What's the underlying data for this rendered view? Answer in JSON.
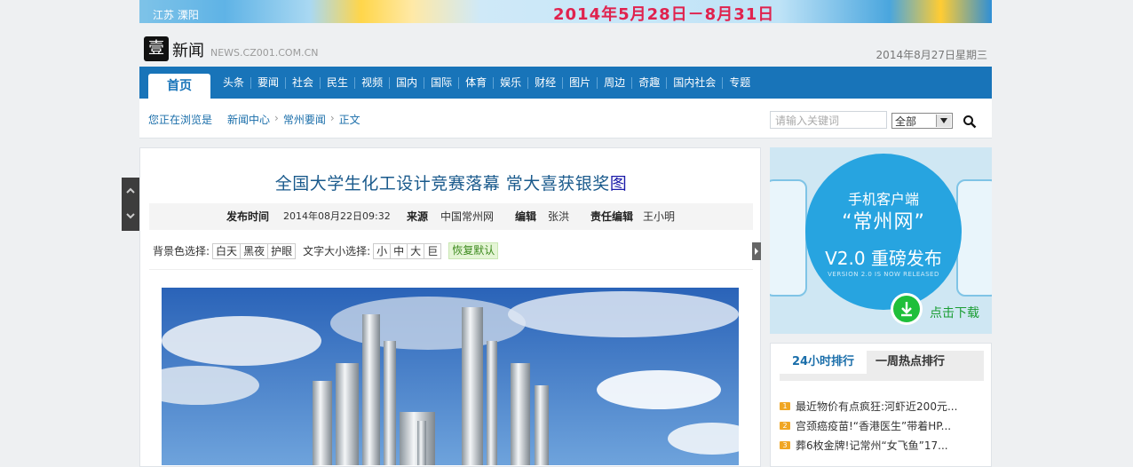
{
  "banner": {
    "location": "江苏  溧阳",
    "date_range": "2014年5月28日－8月31日"
  },
  "header": {
    "logo_char": "壹",
    "logo_text": "新闻",
    "site_url": "NEWS.CZ001.COM.CN",
    "date": "2014年8月27日星期三"
  },
  "nav": {
    "home": "首页",
    "items": [
      "头条",
      "要闻",
      "社会",
      "民生",
      "视频",
      "国内",
      "国际",
      "体育",
      "娱乐",
      "财经",
      "图片",
      "周边",
      "奇趣",
      "国内社会",
      "专题"
    ]
  },
  "breadcrumb": {
    "label": "您正在浏览是",
    "items": [
      "新闻中心",
      "常州要闻",
      "正文"
    ]
  },
  "search": {
    "placeholder": "请输入关键词",
    "scope": "全部"
  },
  "article": {
    "title": "全国大学生化工设计竞赛落幕  常大喜获银奖",
    "title_tail": "图",
    "meta": {
      "publish_label": "发布时间",
      "publish_value": "2014年08月22日09:32",
      "source_label": "来源",
      "source_value": "中国常州网",
      "editor_label": "编辑",
      "editor_value": "张洪",
      "chief_label": "责任编辑",
      "chief_value": "王小明"
    },
    "bg_label": "背景色选择:",
    "bg_options": [
      "白天",
      "黑夜",
      "护眼"
    ],
    "font_label": "文字大小选择:",
    "font_options": [
      "小",
      "中",
      "大",
      "巨"
    ],
    "restore": "恢复默认"
  },
  "ad": {
    "line1": "手机客户端",
    "line2": "“常州网”",
    "line3": "V2.0 重磅发布",
    "line4": "VERSION 2.0 IS NOW RELEASED",
    "download": "点击下载"
  },
  "rank": {
    "tab_active": "24小时排行",
    "tab_other": "一周热点排行",
    "items": [
      {
        "num": "1",
        "text": "最近物价有点疯狂:河虾近200元..."
      },
      {
        "num": "2",
        "text": "宫颈癌疫苗!“香港医生”带着HP..."
      },
      {
        "num": "3",
        "text": "葬6枚金牌!记常州“女飞鱼”17..."
      }
    ]
  },
  "colors": {
    "nav_blue": "#1874b9",
    "title_blue": "#1a5a8c",
    "ad_blue": "#27a4e0",
    "rank_badge": "#f0a623"
  }
}
